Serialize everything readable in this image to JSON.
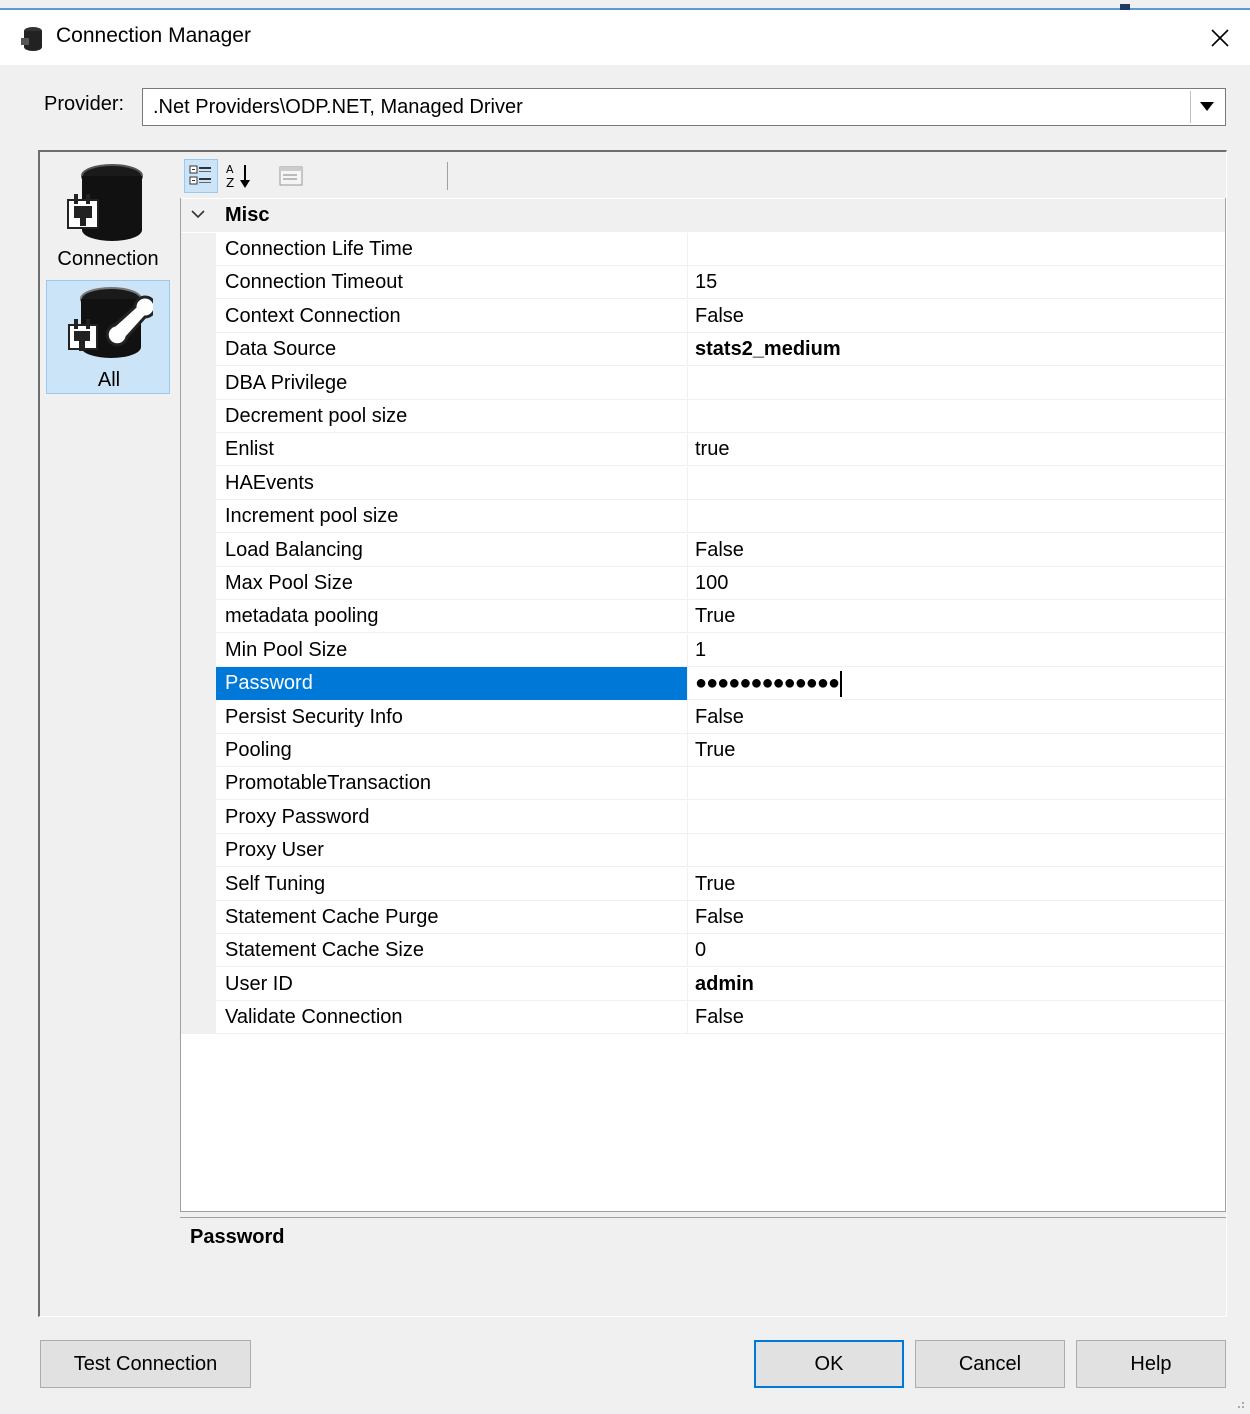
{
  "window": {
    "title": "Connection Manager",
    "close_glyph": "✕"
  },
  "provider": {
    "label": "Provider:",
    "value": ".Net Providers\\ODP.NET, Managed Driver"
  },
  "sidebar": {
    "items": [
      {
        "label": "Connection",
        "icon": "database-plug-icon"
      },
      {
        "label": "All",
        "icon": "database-plug-wrench-icon"
      }
    ]
  },
  "toolbar": {
    "categorized_icon": "categorized-icon",
    "alphabetical_icon": "alphabetical-sort-icon",
    "property_pages_icon": "property-pages-icon"
  },
  "category": {
    "label": "Misc"
  },
  "properties": [
    {
      "name": "Connection Life Time",
      "value": ""
    },
    {
      "name": "Connection Timeout",
      "value": "15"
    },
    {
      "name": "Context Connection",
      "value": "False"
    },
    {
      "name": "Data Source",
      "value": "stats2_medium"
    },
    {
      "name": "DBA Privilege",
      "value": ""
    },
    {
      "name": "Decrement pool size",
      "value": ""
    },
    {
      "name": "Enlist",
      "value": "true"
    },
    {
      "name": "HAEvents",
      "value": ""
    },
    {
      "name": "Increment pool size",
      "value": ""
    },
    {
      "name": "Load Balancing",
      "value": "False"
    },
    {
      "name": "Max Pool Size",
      "value": "100"
    },
    {
      "name": "metadata pooling",
      "value": "True"
    },
    {
      "name": "Min Pool Size",
      "value": "1"
    },
    {
      "name": "Password",
      "value": "●●●●●●●●●●●●●"
    },
    {
      "name": "Persist Security Info",
      "value": "False"
    },
    {
      "name": "Pooling",
      "value": "True"
    },
    {
      "name": "PromotableTransaction",
      "value": ""
    },
    {
      "name": "Proxy Password",
      "value": ""
    },
    {
      "name": "Proxy User",
      "value": ""
    },
    {
      "name": "Self Tuning",
      "value": "True"
    },
    {
      "name": "Statement Cache Purge",
      "value": "False"
    },
    {
      "name": "Statement Cache Size",
      "value": "0"
    },
    {
      "name": "User ID",
      "value": "admin"
    },
    {
      "name": "Validate Connection",
      "value": "False"
    }
  ],
  "description": {
    "title": "Password"
  },
  "buttons": {
    "test": "Test Connection",
    "ok": "OK",
    "cancel": "Cancel",
    "help": "Help"
  },
  "colors": {
    "selection": "#0078d7",
    "selected_tab": "#cce4f7",
    "accent_line": "#5b9bd5"
  }
}
